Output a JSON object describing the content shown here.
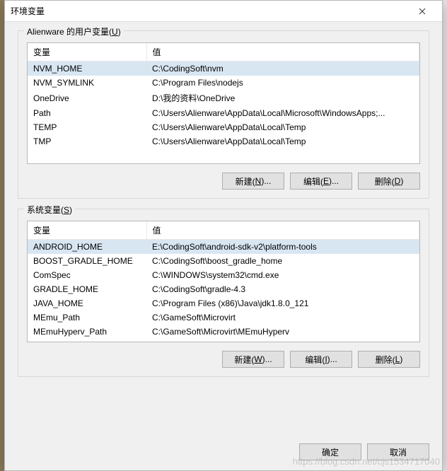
{
  "window": {
    "title": "环境变量"
  },
  "userGroup": {
    "label_prefix": "Alienware 的用户变量(",
    "label_key": "U",
    "label_suffix": ")",
    "headers": {
      "var": "变量",
      "val": "值"
    },
    "rows": [
      {
        "var": "NVM_HOME",
        "val": "C:\\CodingSoft\\nvm",
        "selected": true
      },
      {
        "var": "NVM_SYMLINK",
        "val": "C:\\Program Files\\nodejs",
        "selected": false
      },
      {
        "var": "OneDrive",
        "val": "D:\\我的资料\\OneDrive",
        "selected": false
      },
      {
        "var": "Path",
        "val": "C:\\Users\\Alienware\\AppData\\Local\\Microsoft\\WindowsApps;...",
        "selected": false
      },
      {
        "var": "TEMP",
        "val": "C:\\Users\\Alienware\\AppData\\Local\\Temp",
        "selected": false
      },
      {
        "var": "TMP",
        "val": "C:\\Users\\Alienware\\AppData\\Local\\Temp",
        "selected": false
      }
    ],
    "buttons": {
      "new_text": "新建(",
      "new_key": "N",
      "new_suffix": ")...",
      "edit_text": "编辑(",
      "edit_key": "E",
      "edit_suffix": ")...",
      "del_text": "删除(",
      "del_key": "D",
      "del_suffix": ")"
    }
  },
  "sysGroup": {
    "label_prefix": "系统变量(",
    "label_key": "S",
    "label_suffix": ")",
    "headers": {
      "var": "变量",
      "val": "值"
    },
    "rows": [
      {
        "var": "ANDROID_HOME",
        "val": "E:\\CodingSoft\\android-sdk-v2\\platform-tools",
        "selected": true
      },
      {
        "var": "BOOST_GRADLE_HOME",
        "val": "C:\\CodingSoft\\boost_gradle_home",
        "selected": false
      },
      {
        "var": "ComSpec",
        "val": "C:\\WINDOWS\\system32\\cmd.exe",
        "selected": false
      },
      {
        "var": "GRADLE_HOME",
        "val": "C:\\CodingSoft\\gradle-4.3",
        "selected": false
      },
      {
        "var": "JAVA_HOME",
        "val": "C:\\Program Files (x86)\\Java\\jdk1.8.0_121",
        "selected": false
      },
      {
        "var": "MEmu_Path",
        "val": "C:\\GameSoft\\Microvirt",
        "selected": false
      },
      {
        "var": "MEmuHyperv_Path",
        "val": "C:\\GameSoft\\Microvirt\\MEmuHyperv",
        "selected": false
      }
    ],
    "buttons": {
      "new_text": "新建(",
      "new_key": "W",
      "new_suffix": ")...",
      "edit_text": "编辑(",
      "edit_key": "I",
      "edit_suffix": ")...",
      "del_text": "删除(",
      "del_key": "L",
      "del_suffix": ")"
    }
  },
  "footer": {
    "ok": "确定",
    "cancel": "取消"
  },
  "watermark": "https://blog.csdn.net/cjs1534717040"
}
